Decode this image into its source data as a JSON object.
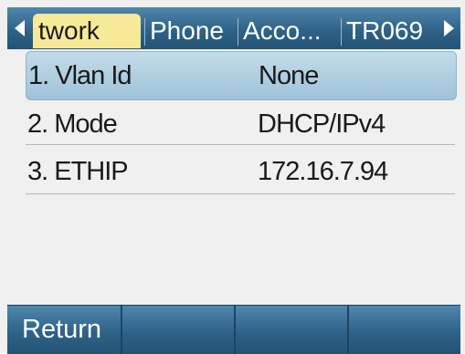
{
  "tabs": [
    {
      "label": "twork",
      "active": true
    },
    {
      "label": "Phone",
      "active": false
    },
    {
      "label": "Acco...",
      "active": false
    },
    {
      "label": "TR069",
      "active": false
    }
  ],
  "rows": [
    {
      "label": "1. Vlan Id",
      "value": "None",
      "selected": true
    },
    {
      "label": "2. Mode",
      "value": "DHCP/IPv4",
      "selected": false
    },
    {
      "label": "3. ETHIP",
      "value": "172.16.7.94",
      "selected": false
    }
  ],
  "softkeys": [
    "Return",
    "",
    "",
    ""
  ],
  "colors": {
    "bar": "#2f6288",
    "active_tab": "#f7e998",
    "selected_row": "#a8c8dc"
  }
}
